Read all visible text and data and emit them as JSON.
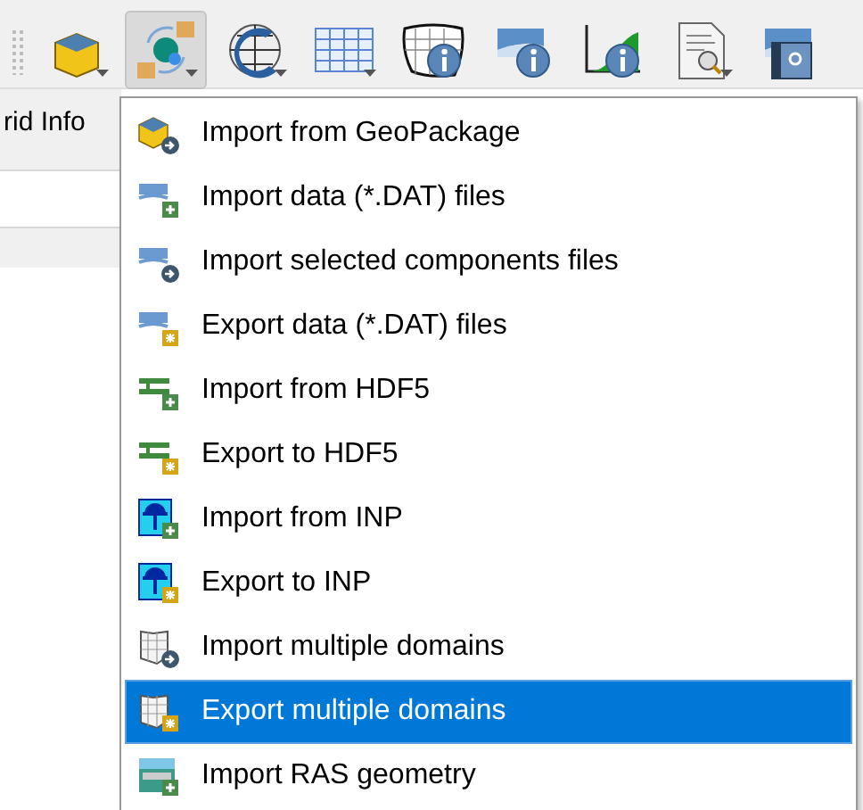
{
  "toolbar": {
    "buttons": [
      {
        "kind": "geopackage",
        "selected": false,
        "dropdown": true
      },
      {
        "kind": "import-export",
        "selected": true,
        "dropdown": true
      },
      {
        "kind": "grid-globe",
        "selected": false,
        "dropdown": true
      },
      {
        "kind": "table",
        "selected": false,
        "dropdown": true
      },
      {
        "kind": "mesh-info",
        "selected": false,
        "dropdown": false
      },
      {
        "kind": "info",
        "selected": false,
        "dropdown": false
      },
      {
        "kind": "profile-info",
        "selected": false,
        "dropdown": false
      },
      {
        "kind": "report",
        "selected": false,
        "dropdown": true
      },
      {
        "kind": "help",
        "selected": false,
        "dropdown": false
      }
    ]
  },
  "tab": {
    "label": "rid Info"
  },
  "menu": {
    "items": [
      {
        "label": "Import from GeoPackage",
        "selected": false
      },
      {
        "label": "Import data (*.DAT) files",
        "selected": false
      },
      {
        "label": "Import selected components files",
        "selected": false
      },
      {
        "label": "Export data (*.DAT) files",
        "selected": false
      },
      {
        "label": "Import from HDF5",
        "selected": false
      },
      {
        "label": "Export to HDF5",
        "selected": false
      },
      {
        "label": "Import from INP",
        "selected": false
      },
      {
        "label": "Export to INP",
        "selected": false
      },
      {
        "label": "Import multiple domains",
        "selected": false
      },
      {
        "label": "Export multiple domains",
        "selected": true
      },
      {
        "label": "Import RAS geometry",
        "selected": false
      }
    ]
  }
}
